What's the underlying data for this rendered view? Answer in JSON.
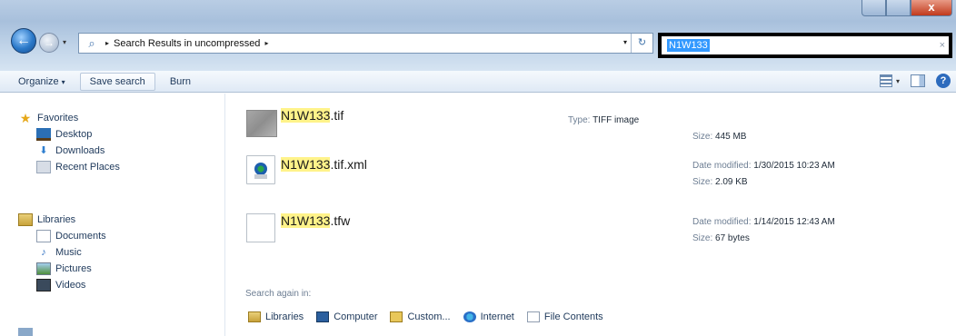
{
  "window": {
    "close_glyph": "x",
    "back_glyph": "←",
    "forward_glyph": "→"
  },
  "address_bar": {
    "breadcrumb": "Search Results in uncompressed",
    "separator": "▸",
    "trailing_separator": "▸"
  },
  "search": {
    "query": "N1W133",
    "clear_glyph": "×"
  },
  "toolbar": {
    "organize_label": "Organize",
    "save_search_label": "Save search",
    "burn_label": "Burn",
    "help_glyph": "?"
  },
  "sidebar": {
    "favorites": {
      "label": "Favorites",
      "items": [
        "Desktop",
        "Downloads",
        "Recent Places"
      ]
    },
    "libraries": {
      "label": "Libraries",
      "items": [
        "Documents",
        "Music",
        "Pictures",
        "Videos"
      ]
    }
  },
  "results": [
    {
      "name_highlight": "N1W133",
      "name_rest": ".tif",
      "type_label": "Type:",
      "type_value": "TIFF image",
      "size_label": "Size:",
      "size_value": "445 MB",
      "icon": "image-thumbnail-icon"
    },
    {
      "name_highlight": "N1W133",
      "name_rest": ".tif.xml",
      "date_label": "Date modified:",
      "date_value": "1/30/2015 10:23 AM",
      "size_label": "Size:",
      "size_value": "2.09 KB",
      "icon": "xml-file-icon"
    },
    {
      "name_highlight": "N1W133",
      "name_rest": ".tfw",
      "date_label": "Date modified:",
      "date_value": "1/14/2015 12:43 AM",
      "size_label": "Size:",
      "size_value": "67 bytes",
      "icon": "blank-file-icon"
    }
  ],
  "search_again": {
    "label": "Search again in:",
    "locations": [
      "Libraries",
      "Computer",
      "Custom...",
      "Internet",
      "File Contents"
    ]
  },
  "colors": {
    "highlight": "#fff38a",
    "search_selection": "#3399ff",
    "link_text": "#1e395b"
  }
}
